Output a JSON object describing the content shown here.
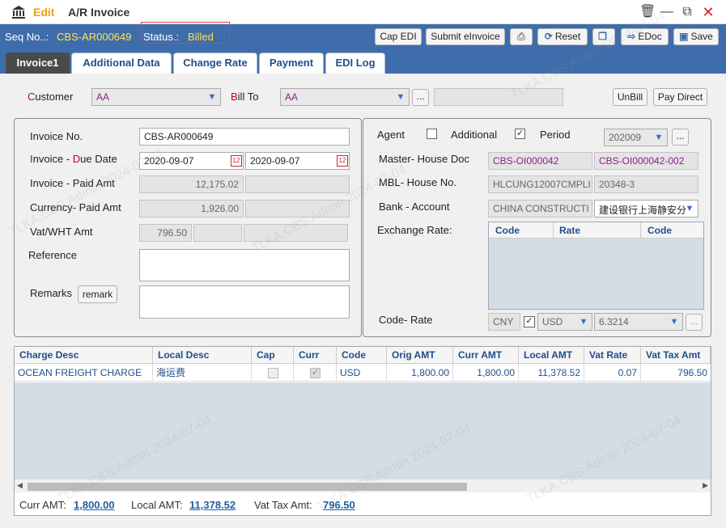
{
  "window": {
    "mode": "Edit",
    "title": "A/R Invoice"
  },
  "header": {
    "seq_label": "Seq No..:",
    "seq_value": "CBS-AR000649",
    "status_label": "Status.:",
    "status_value": "Billed",
    "buttons": {
      "cap_edi": "Cap EDI",
      "submit_einvoice": "Submit eInvoice",
      "reset": "Reset",
      "edoc": "EDoc",
      "save": "Save"
    }
  },
  "tabs": [
    "Invoice1",
    "Additional Data",
    "Change Rate",
    "Payment",
    "EDI Log"
  ],
  "customer": {
    "customer_label": "ustomer",
    "customer_key": "C",
    "customer_value": "AA",
    "bill_to_label": "ill To",
    "bill_to_key": "B",
    "bill_to_value": "AA",
    "ellipsis": "...",
    "unbill": "UnBill",
    "pay_direct": "Pay Direct"
  },
  "left_panel": {
    "invoice_no_label": "Invoice No.",
    "invoice_no": "CBS-AR000649",
    "inv_due_label_i": "I",
    "inv_due_label_rest1": "nvoice - ",
    "inv_due_label_d": "D",
    "inv_due_label_rest2": "ue Date",
    "invoice_date": "2020-09-07",
    "due_date": "2020-09-07",
    "inv_paid_label": "Invoice - Paid Amt",
    "invoice_amt": "12,175.02",
    "curr_paid_label": "Currency- Paid Amt",
    "currency_amt": "1,926.00",
    "vat_label": "Vat/WHT Amt",
    "vat_amt": "796.50",
    "reference_label": "Reference",
    "remarks_label": "Remarks",
    "remark_button": "remark"
  },
  "right_panel": {
    "agent_label": "Agent",
    "additional_label": "Additional",
    "additional_check": "✓",
    "period_label": "Period",
    "period_value": "202009",
    "master_house_label": "Master- House Doc",
    "master_doc": "CBS-OI000042",
    "house_doc": "CBS-OI000042-002",
    "mbl_house_label": "MBL- House No.",
    "mbl_no": "HLCUNG12007CMPLI",
    "house_no": "20348-3",
    "bank_label": "Bank - Account",
    "bank_value": "CHINA CONSTRUCTI",
    "account_value": "建设银行上海静安分",
    "exchange_label": "Exchange Rate:",
    "exchange_cols": [
      "Code",
      "Rate",
      "Code"
    ],
    "code_rate_label": "Code- Rate",
    "code_from": "CNY",
    "code_check": "✓",
    "code_to": "USD",
    "rate": "6.3214"
  },
  "grid": {
    "columns": [
      "Charge Desc",
      "Local Desc",
      "Cap",
      "Curr",
      "Code",
      "Orig AMT",
      "Curr AMT",
      "Local AMT",
      "Vat Rate",
      "Vat Tax Amt"
    ],
    "rows": [
      {
        "charge_desc": "OCEAN FREIGHT CHARGE",
        "local_desc": "海运费",
        "cap": "",
        "curr": "✓",
        "code": "USD",
        "orig_amt": "1,800.00",
        "curr_amt": "1,800.00",
        "local_amt": "11,378.52",
        "vat_rate": "0.07",
        "vat_tax_amt": "796.50"
      }
    ]
  },
  "totals": {
    "curr_label": "Curr AMT:",
    "curr_value": "1,800.00",
    "local_label": "Local AMT:",
    "local_value": "11,378.52",
    "vat_label": "Vat Tax Amt:",
    "vat_value": "796.50"
  },
  "watermark": "TLKA.CBS.Admin 2024-07-04",
  "colors": {
    "brand_blue": "#3f6dab",
    "status_yellow": "#ffe24a",
    "link_blue": "#1f5fa0",
    "required_red": "#c0001a"
  }
}
